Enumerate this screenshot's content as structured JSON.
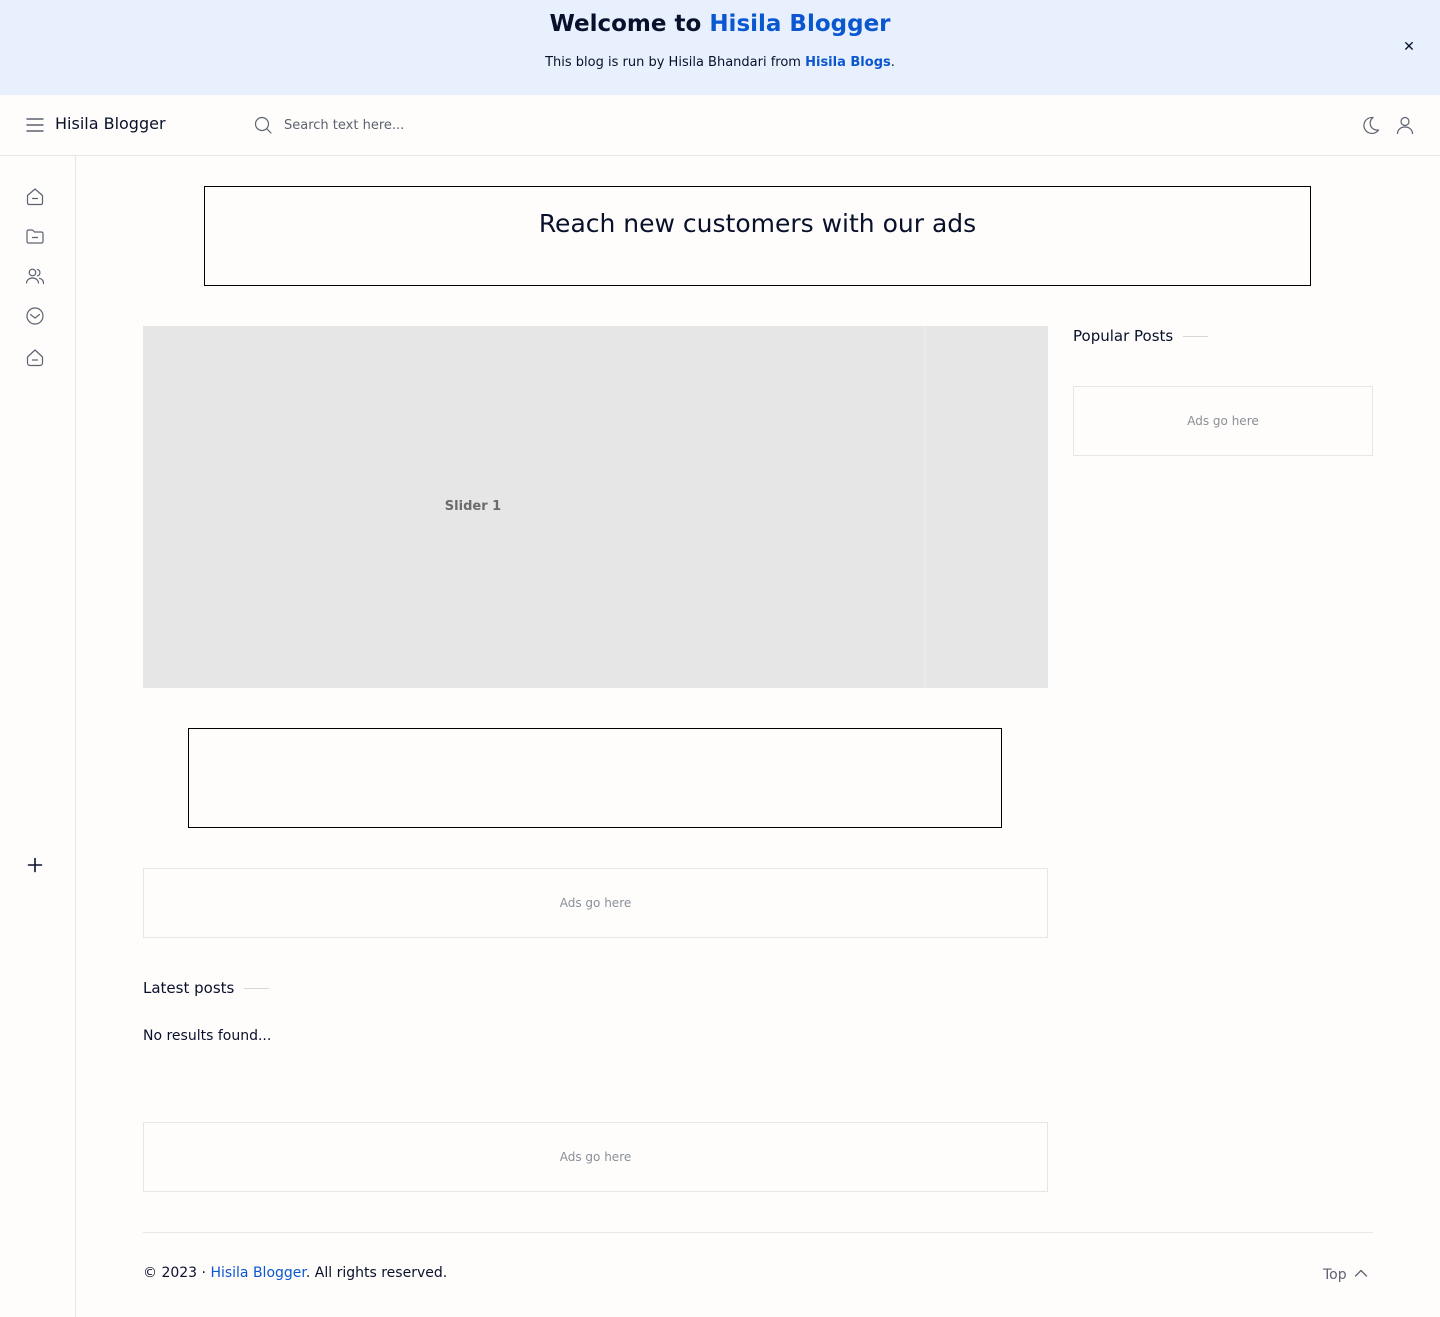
{
  "notice": {
    "welcome_prefix": "Welcome to",
    "welcome_brand": "Hisila Blogger",
    "subtitle_prefix": "This blog is run by Hisila Bhandari from",
    "subtitle_link": "Hisila Blogs",
    "subtitle_suffix": ".",
    "close_label": "✕"
  },
  "header": {
    "title": "Hisila Blogger",
    "search_placeholder": "Search text here..."
  },
  "ads": {
    "top_banner": "Reach new customers with our ads",
    "placeholder": "Ads go here"
  },
  "slider": {
    "label": "Slider 1"
  },
  "sidebar": {
    "popular_title": "Popular Posts"
  },
  "main": {
    "latest_title": "Latest posts",
    "no_results": "No results found..."
  },
  "footer": {
    "copyright_prefix": "© 2023 ·",
    "brand": "Hisila Blogger",
    "suffix": ". All rights reserved.",
    "top_label": "Top"
  },
  "colors": {
    "accent": "#0b57d0",
    "notice_bg": "#e8f0fe",
    "page_bg": "#fefdfb",
    "text": "#08102b"
  }
}
